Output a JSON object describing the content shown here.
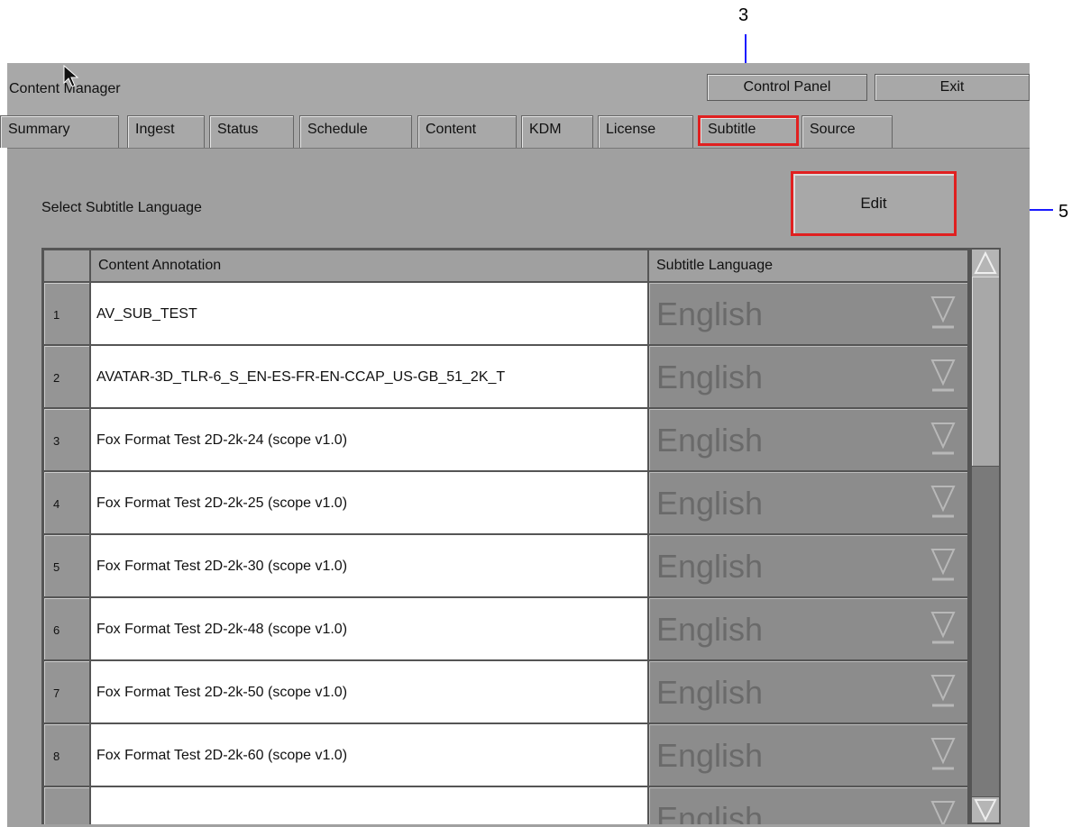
{
  "annotations": {
    "tab_callout": "3",
    "edit_callout": "5"
  },
  "app": {
    "title": "Content Manager",
    "control_panel": "Control Panel",
    "exit": "Exit"
  },
  "tabs": [
    {
      "label": "Summary"
    },
    {
      "label": "Ingest"
    },
    {
      "label": "Status"
    },
    {
      "label": "Schedule"
    },
    {
      "label": "Content"
    },
    {
      "label": "KDM"
    },
    {
      "label": "License"
    },
    {
      "label": "Subtitle",
      "active": true
    },
    {
      "label": "Source"
    }
  ],
  "panel": {
    "select_label": "Select Subtitle Language",
    "edit_button": "Edit"
  },
  "table": {
    "headers": {
      "num": "",
      "annotation": "Content Annotation",
      "language": "Subtitle Language"
    },
    "rows": [
      {
        "num": "1",
        "annotation": "AV_SUB_TEST",
        "language": "English"
      },
      {
        "num": "2",
        "annotation": "AVATAR-3D_TLR-6_S_EN-ES-FR-EN-CCAP_US-GB_51_2K_T",
        "language": "English"
      },
      {
        "num": "3",
        "annotation": "Fox Format Test 2D-2k-24 (scope v1.0)",
        "language": "English"
      },
      {
        "num": "4",
        "annotation": "Fox Format Test 2D-2k-25 (scope v1.0)",
        "language": "English"
      },
      {
        "num": "5",
        "annotation": "Fox Format Test 2D-2k-30 (scope v1.0)",
        "language": "English"
      },
      {
        "num": "6",
        "annotation": "Fox Format Test 2D-2k-48 (scope v1.0)",
        "language": "English"
      },
      {
        "num": "7",
        "annotation": "Fox Format Test 2D-2k-50 (scope v1.0)",
        "language": "English"
      },
      {
        "num": "8",
        "annotation": "Fox Format Test 2D-2k-60 (scope v1.0)",
        "language": "English"
      },
      {
        "num": "",
        "annotation": "",
        "language": "English"
      }
    ]
  },
  "colors": {
    "highlight": "#e02020",
    "arrow": "#1a1aff"
  }
}
